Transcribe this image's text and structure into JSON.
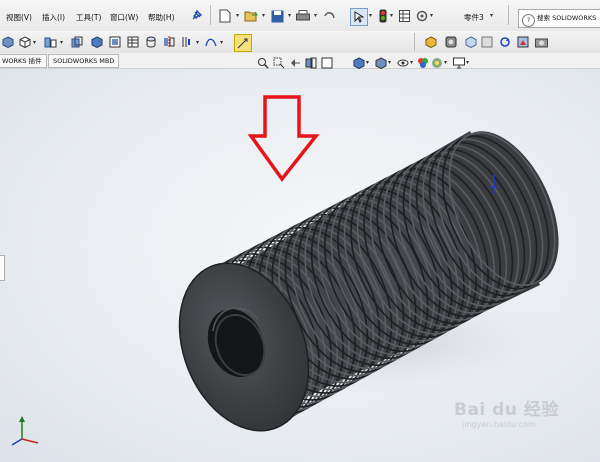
{
  "menus": [
    "视图(V)",
    "插入(I)",
    "工具(T)",
    "窗口(W)",
    "帮助(H)"
  ],
  "document_name": "零件3",
  "search_placeholder": "搜索 SOLIDWORKS",
  "tabs": [
    "WORKS 插件",
    "SOLIDWORKS MBD"
  ],
  "watermark": {
    "logo_text": "Bai du 经验",
    "url": "jingyan.baidu.com"
  },
  "colors": {
    "arrow": "#e8141a",
    "model_body": "#3b3d40",
    "accent": "#1e3fbf"
  },
  "icons": {
    "menubar": [
      "pin-icon",
      "new-document-icon",
      "open-icon",
      "save-icon",
      "print-icon",
      "select-icon",
      "traffic-light-icon",
      "grid-icon",
      "options-icon"
    ],
    "cmdbar": [
      "view-orientation-icon",
      "display-style-icon",
      "section-view-icon",
      "hide-show-icon",
      "edit-appearance-icon",
      "apply-scene-icon",
      "view-settings-icon",
      "temporary-axes-icon",
      "sketch-icon"
    ],
    "heads_up": [
      "zoom-to-fit-icon",
      "zoom-area-icon",
      "previous-view-icon",
      "section-icon",
      "dynamic-annotation-icon",
      "view-orientation-icon",
      "display-style-icon",
      "hide-show-items-icon",
      "appearance-icon",
      "scene-icon",
      "monitor-icon"
    ]
  }
}
